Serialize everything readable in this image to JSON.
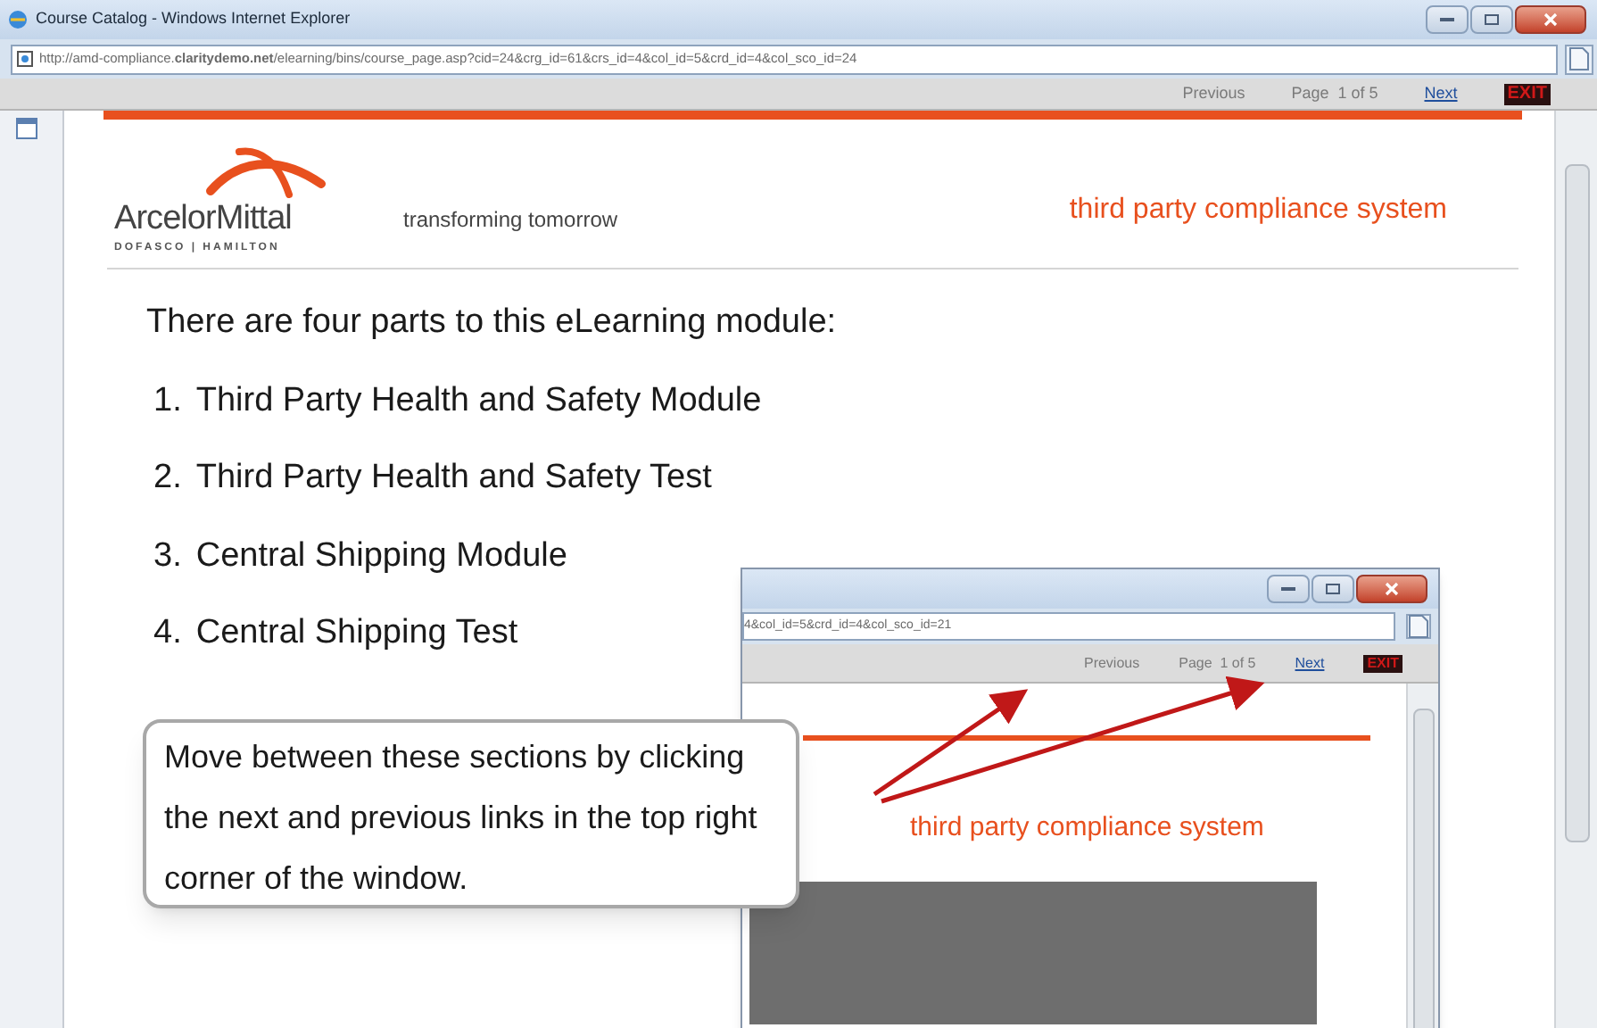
{
  "window": {
    "title": "Course Catalog - Windows Internet Explorer",
    "address": "http://amd-compliance.**claritydemo.net**/elearning/bins/course_page.asp?cid=24&crg_id=61&crs_id=4&col_id=5&crd_id=4&col_sco_id=24"
  },
  "nav": {
    "previous": "Previous",
    "page": "Page  1 of 5",
    "next": "Next",
    "exit": "EXIT"
  },
  "header": {
    "brand": "ArcelorMittal",
    "brand_sub": "DOFASCO | HAMILTON",
    "tagline": "transforming tomorrow",
    "system": "third party compliance system"
  },
  "intro": "There are four parts to this eLearning module:",
  "parts": [
    {
      "number": "1.",
      "label": "Third Party Health and Safety Module"
    },
    {
      "number": "2.",
      "label": "Third Party Health and Safety Test"
    },
    {
      "number": "3.",
      "label": "Central Shipping Module"
    },
    {
      "number": "4.",
      "label": "Central Shipping Test"
    }
  ],
  "callout": "Move between these sections by clicking the next and previous links in the top right corner of the window.",
  "inset": {
    "address": "4&col_id=5&crd_id=4&col_sco_id=21",
    "previous": "Previous",
    "page": "Page  1 of 5",
    "next": "Next",
    "exit": "EXIT",
    "system": "third party compliance system"
  }
}
